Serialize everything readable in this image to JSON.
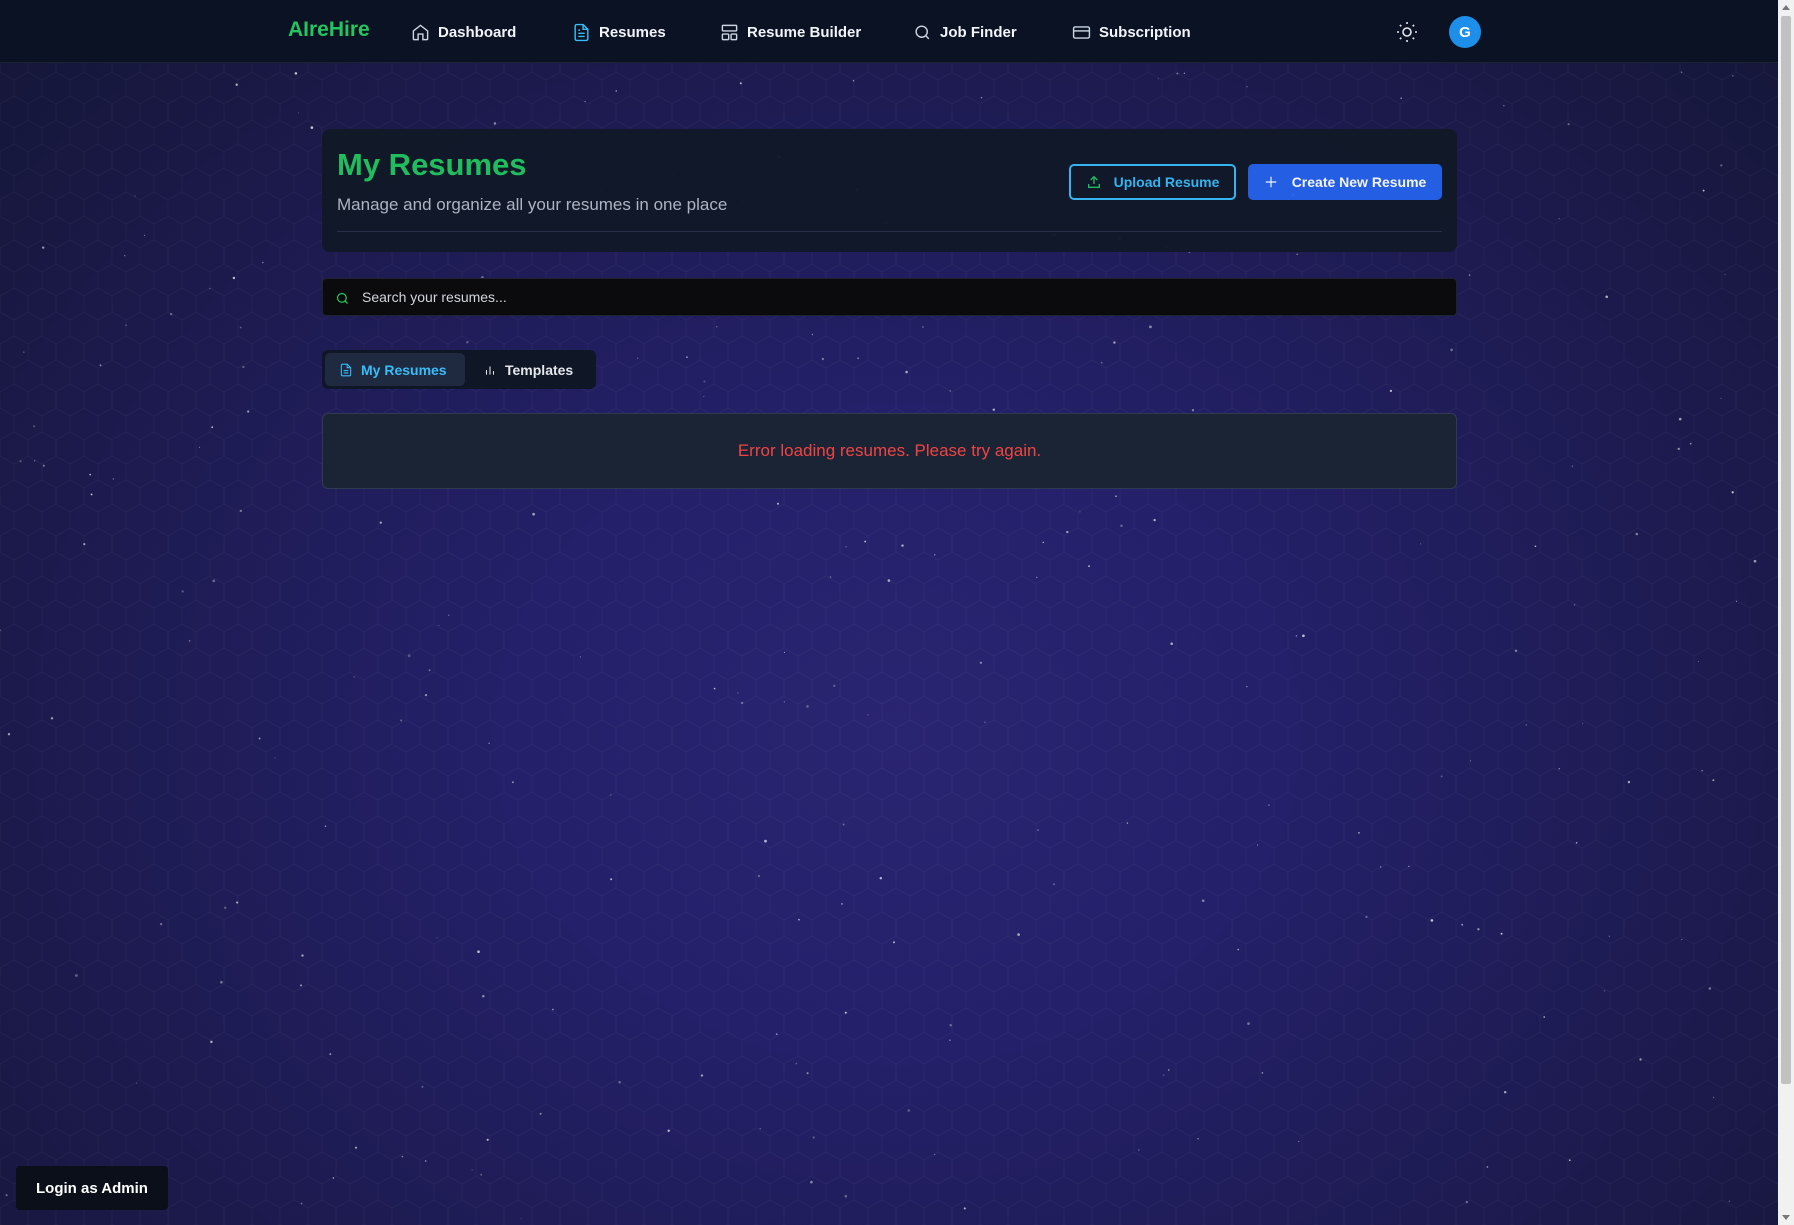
{
  "nav": {
    "brand": "AIreHire",
    "items": [
      {
        "label": "Dashboard",
        "icon": "home-icon"
      },
      {
        "label": "Resumes",
        "icon": "file-text-icon"
      },
      {
        "label": "Resume Builder",
        "icon": "layout-icon"
      },
      {
        "label": "Job Finder",
        "icon": "search-icon"
      },
      {
        "label": "Subscription",
        "icon": "credit-card-icon"
      }
    ],
    "active": "Resumes",
    "avatar_initial": "G",
    "theme_icon": "sun-icon"
  },
  "header": {
    "title": "My Resumes",
    "subtitle": "Manage and organize all your resumes in one place",
    "upload_label": "Upload Resume",
    "create_label": "Create New Resume"
  },
  "search": {
    "placeholder": "Search your resumes...",
    "value": ""
  },
  "tabs": [
    {
      "label": "My Resumes",
      "icon": "file-text-icon",
      "active": true
    },
    {
      "label": "Templates",
      "icon": "bar-chart-icon",
      "active": false
    }
  ],
  "error": {
    "message": "Error loading resumes. Please try again."
  },
  "admin": {
    "label": "Login as Admin"
  },
  "colors": {
    "brand": "#22c55e",
    "accent": "#38bdf8",
    "primary": "#2563eb",
    "error": "#ef4444",
    "nav_bg": "#0b1223"
  }
}
